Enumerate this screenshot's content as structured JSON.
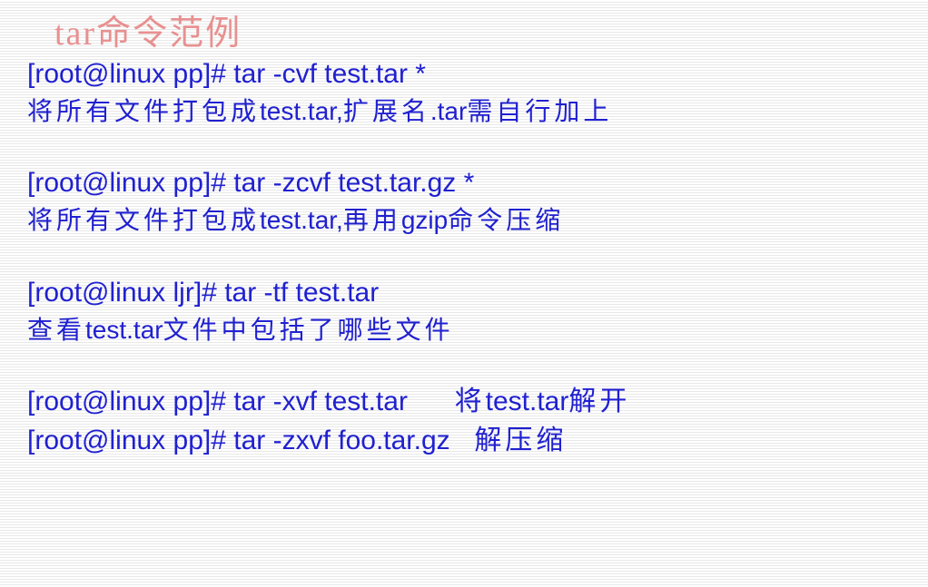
{
  "title": "tar命令范例",
  "blocks": [
    {
      "command": "[root@linux pp]# tar  -cvf  test.tar   *",
      "description_pre": "将所有文件打包成",
      "description_mid": "test.tar,",
      "description_post": "扩展名",
      "description_mid2": ".tar",
      "description_end": "需自行加上"
    },
    {
      "command": "[root@linux pp]# tar  -zcvf  test.tar.gz  *",
      "description_pre": "将所有文件打包成",
      "description_mid": "test.tar,",
      "description_post": "再用",
      "description_mid2": "gzip",
      "description_end": "命令压缩"
    },
    {
      "command": "[root@linux ljr]# tar  -tf   test.tar",
      "description_pre": "查看",
      "description_mid": "test.tar",
      "description_post": "文件中包括了哪些文件",
      "description_mid2": "",
      "description_end": ""
    }
  ],
  "lastBlock": {
    "line1_cmd": "[root@linux pp]# tar  -xvf test.tar",
    "line1_desc_pre": "将",
    "line1_desc_mid": "test.tar",
    "line1_desc_post": "解开",
    "line2_cmd": "[root@linux pp]# tar  -zxvf foo.tar.gz",
    "line2_desc": "解压缩"
  }
}
